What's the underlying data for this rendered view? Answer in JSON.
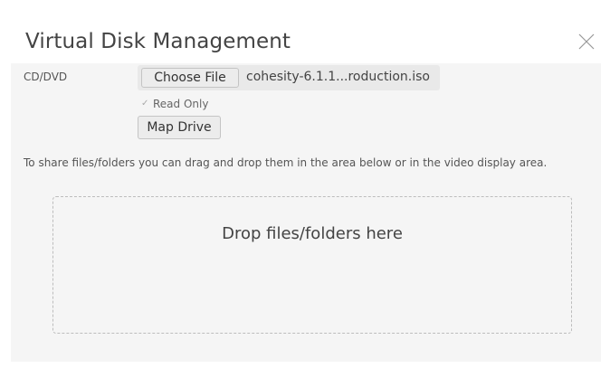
{
  "dialog": {
    "title": "Virtual Disk Management"
  },
  "cd_dvd": {
    "label": "CD/DVD",
    "choose_file_label": "Choose File",
    "file_name": "cohesity-6.1.1...roduction.iso",
    "read_only_label": "Read Only",
    "read_only_checked": true,
    "map_drive_label": "Map Drive"
  },
  "share": {
    "hint": "To share files/folders you can drag and drop them in the area below or in the video display area.",
    "drop_text": "Drop files/folders here"
  },
  "icons": {
    "close": "close-icon",
    "checkbox": "checkbox-checked-icon"
  }
}
